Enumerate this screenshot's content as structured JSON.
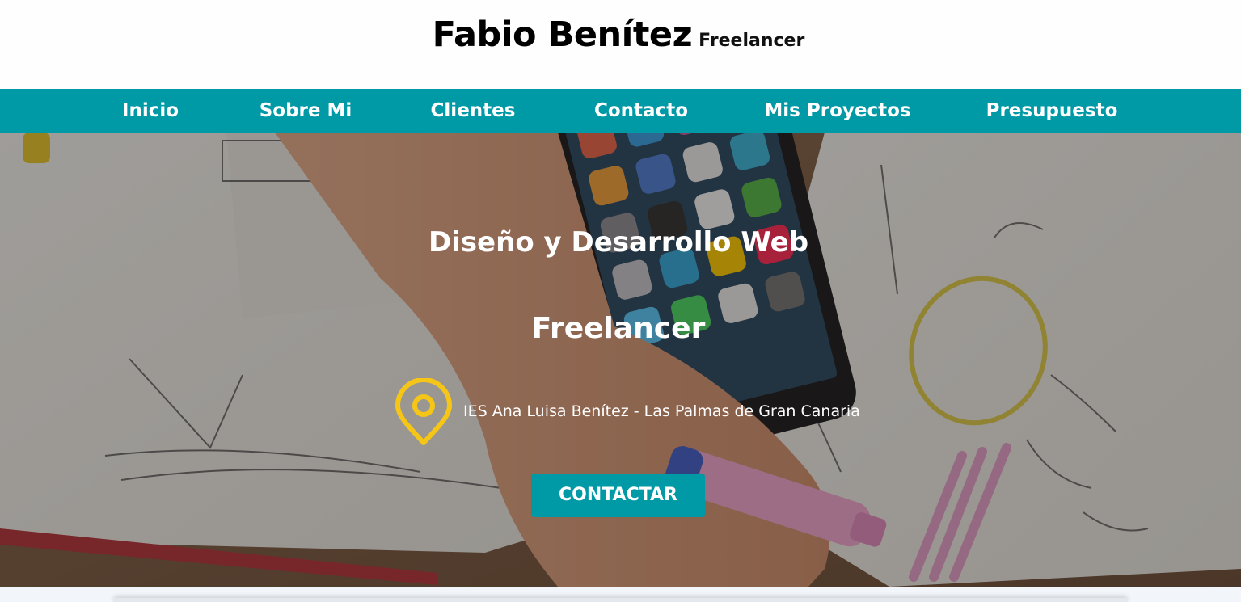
{
  "header": {
    "name": "Fabio Benítez",
    "tagline": "Freelancer"
  },
  "nav": {
    "items": [
      {
        "label": "Inicio"
      },
      {
        "label": "Sobre Mi"
      },
      {
        "label": "Clientes"
      },
      {
        "label": "Contacto"
      },
      {
        "label": "Mis Proyectos"
      },
      {
        "label": "Presupuesto"
      }
    ]
  },
  "hero": {
    "title": "Diseño y Desarrollo Web",
    "subtitle": "Freelancer",
    "location": {
      "icon": "map-pin-icon",
      "text": "IES Ana Luisa Benítez - Las Palmas de Gran Canaria"
    },
    "cta_label": "CONTACTAR",
    "background": "photo-hands-sketching-with-smartphone"
  },
  "colors": {
    "accent": "#0099a6",
    "pin": "#f5c518",
    "header_bg": "#fefefe",
    "page_bg": "#f2f6fa"
  }
}
